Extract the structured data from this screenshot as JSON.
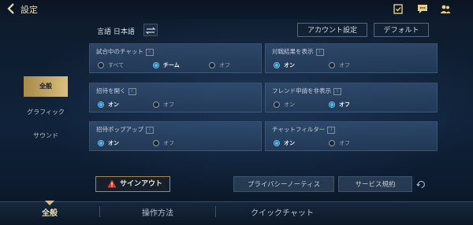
{
  "header": {
    "title": "設定",
    "icons": [
      "back-icon",
      "checklist-icon",
      "chat-icon",
      "friends-icon"
    ]
  },
  "toolbar": {
    "language_label": "言語 日本語",
    "account_settings": "アカウント設定",
    "default": "デフォルト"
  },
  "sidebar": {
    "items": [
      {
        "label": "全般",
        "active": true
      },
      {
        "label": "グラフィック",
        "active": false
      },
      {
        "label": "サウンド",
        "active": false
      }
    ]
  },
  "settings": {
    "match_chat": {
      "label": "試合中のチャット",
      "options": [
        "すべて",
        "チーム",
        "オフ"
      ],
      "selected": "チーム"
    },
    "battle_result": {
      "label": "対戦結果を表示",
      "options": [
        "オン",
        "オフ"
      ],
      "selected": "オン"
    },
    "invite_open": {
      "label": "招待を開く",
      "options": [
        "オン",
        "オフ"
      ],
      "selected": "オン"
    },
    "friend_request_hide": {
      "label": "フレンド申請を非表示",
      "options": [
        "オン",
        "オフ"
      ],
      "selected": "オフ"
    },
    "invite_popup": {
      "label": "招待ポップアップ",
      "options": [
        "オン",
        "オフ"
      ],
      "selected": "オン"
    },
    "chat_filter": {
      "label": "チャットフィルター",
      "options": [
        "オン",
        "オフ"
      ],
      "selected": "オン"
    }
  },
  "footer": {
    "sign_out": "サインアウト",
    "privacy_notice": "プライバシーノーティス",
    "terms_of_service": "サービス規約"
  },
  "bottom_tabs": [
    {
      "label": "全般",
      "active": true
    },
    {
      "label": "操作方法",
      "active": false
    },
    {
      "label": "クイックチャット",
      "active": false
    }
  ],
  "colors": {
    "accent_gold": "#d9bf7e",
    "radio_selected": "#4fb4ec",
    "warning_red": "#e03a2e"
  }
}
